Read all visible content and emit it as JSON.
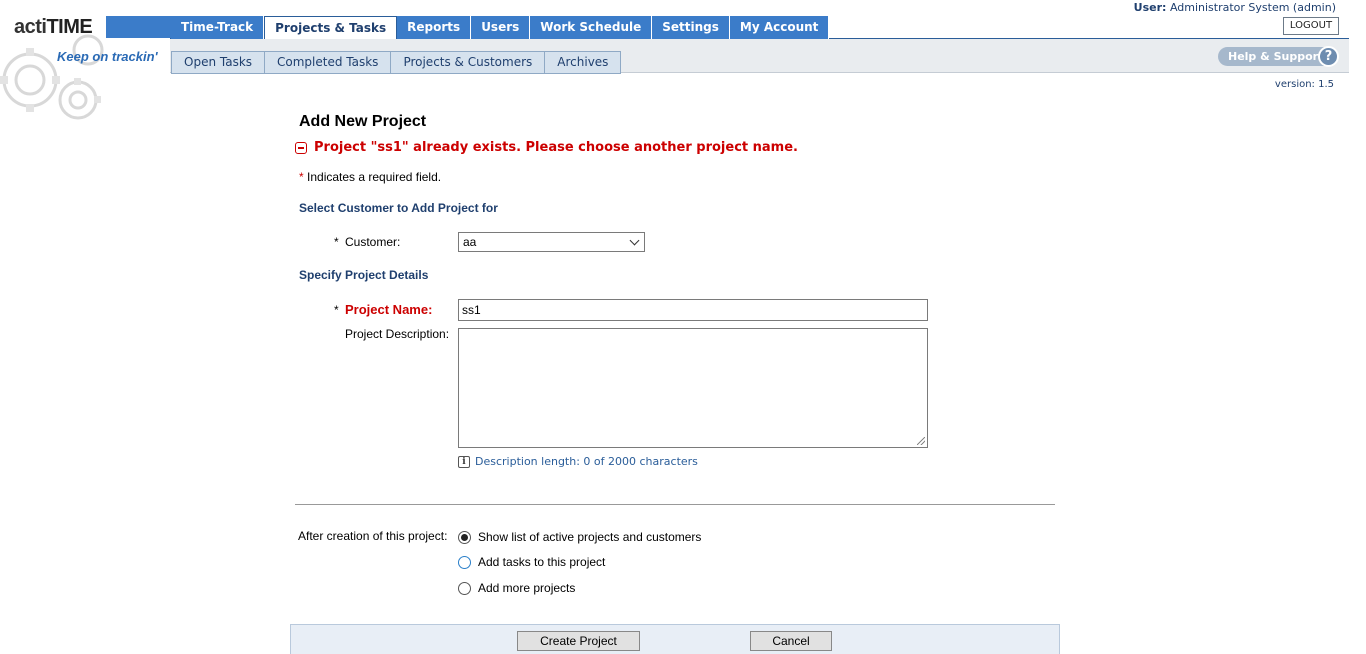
{
  "app": {
    "logo_prefix": "acti",
    "logo_suffix": "TIME",
    "tagline": "Keep on trackin'",
    "version": "version: 1.5"
  },
  "nav": {
    "tabs": [
      {
        "label": "Time-Track"
      },
      {
        "label": "Projects & Tasks"
      },
      {
        "label": "Reports"
      },
      {
        "label": "Users"
      },
      {
        "label": "Work Schedule"
      },
      {
        "label": "Settings"
      },
      {
        "label": "My Account"
      }
    ],
    "active_tab": "Projects & Tasks",
    "subtabs": [
      {
        "label": "Open Tasks"
      },
      {
        "label": "Completed Tasks"
      },
      {
        "label": "Projects & Customers"
      },
      {
        "label": "Archives"
      }
    ]
  },
  "user": {
    "prefix": "User:",
    "name": "Administrator System (admin)",
    "logout_label": "LOGOUT",
    "help_label": "Help & Support",
    "help_icon": "?"
  },
  "form": {
    "title": "Add New Project",
    "error": "Project \"ss1\" already exists. Please choose another project name.",
    "required_mark": "*",
    "required_note": "Indicates a required field.",
    "section_customer": "Select Customer to Add Project for",
    "customer_label": "Customer:",
    "customer_value": "aa",
    "section_details": "Specify Project Details",
    "project_name_label": "Project Name:",
    "project_name_value": "ss1",
    "description_label": "Project Description:",
    "description_value": "",
    "description_length": "Description length: 0 of 2000 characters",
    "info_icon": "i",
    "after_creation_label": "After creation of this project:",
    "after_options": [
      {
        "label": "Show list of active projects and customers",
        "checked": true
      },
      {
        "label": "Add tasks to this project",
        "checked": false
      },
      {
        "label": "Add more projects",
        "checked": false
      }
    ],
    "create_button": "Create Project",
    "cancel_button": "Cancel"
  },
  "colors": {
    "nav_blue": "#3b7cc9",
    "error_red": "#cc0000",
    "section_blue": "#1f3f6e"
  }
}
